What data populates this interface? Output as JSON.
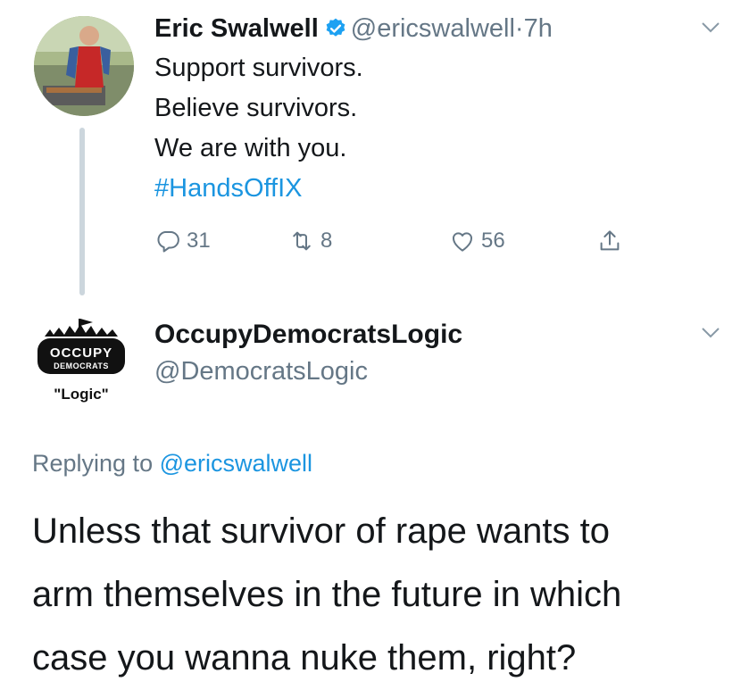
{
  "tweet1": {
    "name": "Eric Swalwell",
    "handle": "@ericswalwell",
    "separator": "·",
    "time": "7h",
    "lines": [
      "Support survivors.",
      "Believe survivors.",
      "We are with you."
    ],
    "hashtag": "#HandsOffIX",
    "counts": {
      "replies": "31",
      "retweets": "8",
      "likes": "56"
    }
  },
  "tweet2": {
    "name": "OccupyDemocratsLogic",
    "handle": "@DemocratsLogic",
    "avatar_text": {
      "top": "OCCUPY",
      "sub": "DEMOCRATS",
      "caption": "\"Logic\""
    },
    "replying_prefix": "Replying to",
    "replying_to": "@ericswalwell",
    "lines": [
      "Unless that survivor of rape wants to",
      "arm themselves in the future in which",
      "case you wanna nuke them, right?"
    ]
  },
  "icons": {
    "reply": "reply-icon",
    "retweet": "retweet-icon",
    "like": "heart-icon",
    "share": "share-icon",
    "verified": "verified-badge-icon",
    "caret": "chevron-down-icon"
  },
  "colors": {
    "link": "#1b95e0",
    "muted": "#657786",
    "text": "#14171a",
    "thread": "#ccd6dd"
  }
}
